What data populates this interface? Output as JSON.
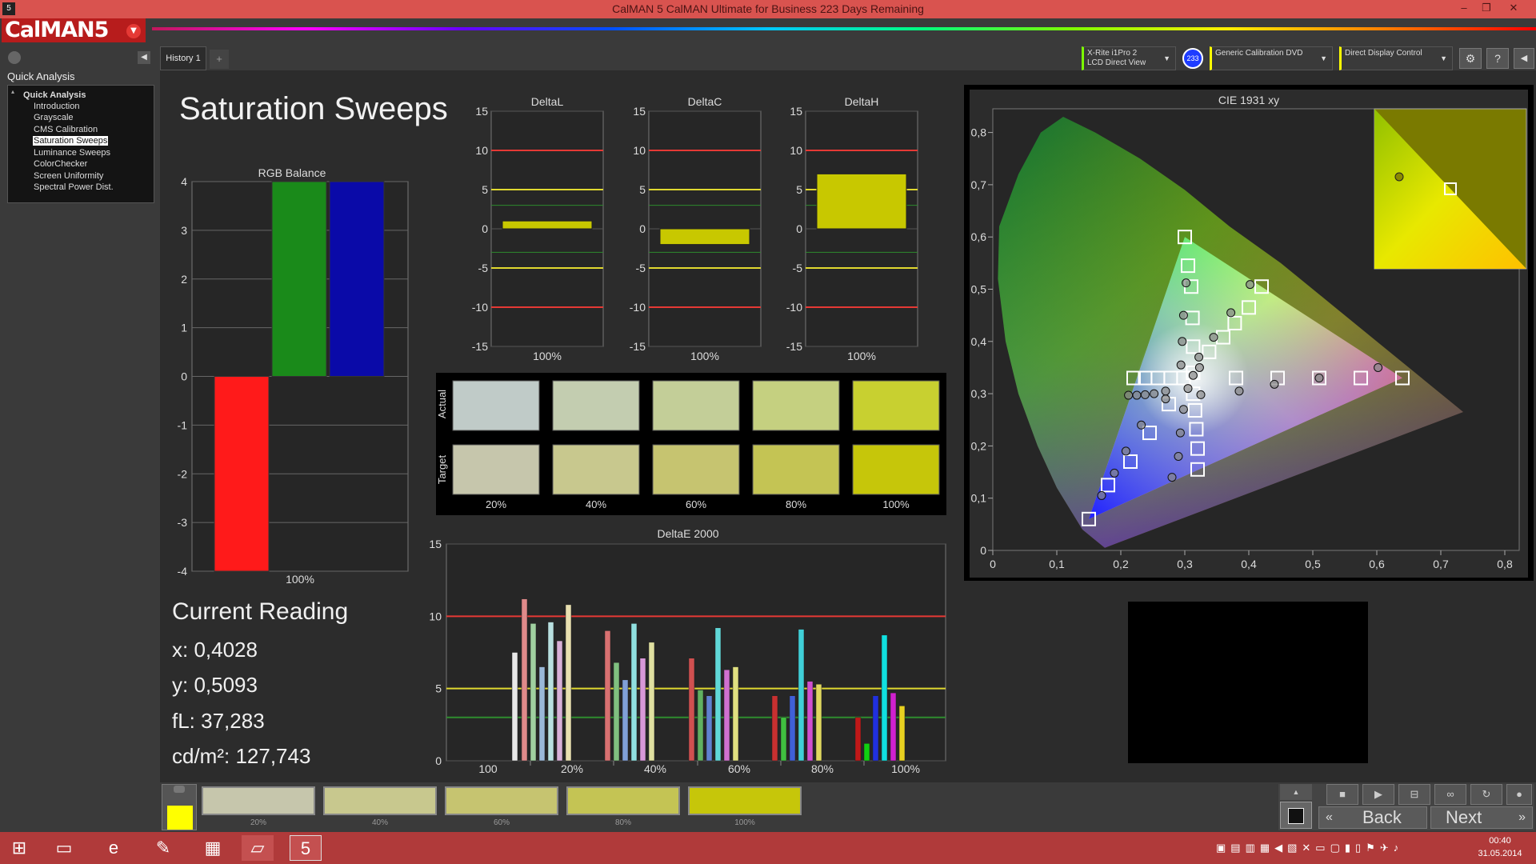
{
  "window": {
    "title": "CalMAN 5 CalMAN Ultimate for Business 223 Days Remaining",
    "logo": "CalMAN5",
    "logo_menu": "▼"
  },
  "tabs": [
    {
      "label": "History 1"
    },
    {
      "label": "+"
    }
  ],
  "devices": [
    {
      "label": "X-Rite i1Pro 2",
      "sub": "LCD Direct View",
      "color": "#7cfc00"
    },
    {
      "label": "233",
      "color": "#1e3cff"
    },
    {
      "label": "Generic Calibration DVD",
      "color": "#ffff00"
    },
    {
      "label": "Direct Display Control",
      "color": "#ffff00"
    }
  ],
  "sidebar": {
    "heading": "Quick Analysis",
    "root": "Quick Analysis",
    "items": [
      "Introduction",
      "Grayscale",
      "CMS Calibration",
      "Saturation Sweeps",
      "Luminance Sweeps",
      "ColorChecker",
      "Screen Uniformity",
      "Spectral Power Dist."
    ],
    "selected": "Saturation Sweeps"
  },
  "page": {
    "title": "Saturation Sweeps"
  },
  "reading": {
    "heading": "Current Reading",
    "x": "x: 0,4028",
    "y": "y: 0,5093",
    "fl": "fL: 37,283",
    "cd": "cd/m²: 127,743"
  },
  "colors": {
    "accent_yellow": "#c8c800",
    "red_line": "#e53935",
    "yellow_line": "#e0d830",
    "green_line": "#2e8b2e"
  },
  "chart_data": [
    {
      "type": "bar",
      "title": "RGB Balance",
      "categories": [
        "100%"
      ],
      "series": [
        {
          "name": "R",
          "values": [
            -4.0
          ],
          "color": "#ff1a1a"
        },
        {
          "name": "G",
          "values": [
            4.0
          ],
          "color": "#1a8a1a"
        },
        {
          "name": "B",
          "values": [
            4.0
          ],
          "color": "#0a0aa8"
        }
      ],
      "ylim": [
        -4,
        4
      ],
      "yticks": [
        "4",
        "3",
        "2",
        "1",
        "0",
        "-1",
        "-2",
        "-3",
        "-4"
      ]
    },
    {
      "type": "bar",
      "title": "DeltaL",
      "categories": [
        "100%"
      ],
      "values": [
        1.0
      ],
      "ylim": [
        -15,
        15
      ],
      "yticks": [
        "15",
        "10",
        "5",
        "0",
        "-5",
        "-10",
        "-15"
      ]
    },
    {
      "type": "bar",
      "title": "DeltaC",
      "categories": [
        "100%"
      ],
      "values": [
        -2.0
      ],
      "ylim": [
        -15,
        15
      ],
      "yticks": [
        "15",
        "10",
        "5",
        "0",
        "-5",
        "-10",
        "-15"
      ]
    },
    {
      "type": "bar",
      "title": "DeltaH",
      "categories": [
        "100%"
      ],
      "values": [
        7.0
      ],
      "ylim": [
        -15,
        15
      ],
      "yticks": [
        "15",
        "10",
        "5",
        "0",
        "-5",
        "-10",
        "-15"
      ]
    },
    {
      "type": "table",
      "title": "Swatches",
      "rows": [
        "Actual",
        "Target"
      ],
      "columns": [
        "20%",
        "40%",
        "60%",
        "80%",
        "100%"
      ],
      "actual": [
        "#c0cbc8",
        "#c3cdb0",
        "#c3ce98",
        "#c5d080",
        "#c8d030"
      ],
      "target": [
        "#c6c6ac",
        "#c8c88e",
        "#c6c470",
        "#c4c454",
        "#c6c60a"
      ]
    },
    {
      "type": "bar",
      "title": "DeltaE 2000",
      "categories": [
        "100",
        "20%",
        "40%",
        "60%",
        "80%",
        "100%"
      ],
      "ylim": [
        0,
        15
      ],
      "yticks": [
        "15",
        "10",
        "5",
        "0"
      ],
      "groups": [
        {
          "label": "100",
          "bars": [
            {
              "value": 7.5,
              "color": "#e8e8e8"
            }
          ]
        },
        {
          "label": "20%",
          "bars": [
            {
              "value": 11.2,
              "color": "#e08a8a"
            },
            {
              "value": 9.5,
              "color": "#a0d0a0"
            },
            {
              "value": 6.5,
              "color": "#9ab8d8"
            },
            {
              "value": 9.6,
              "color": "#b8e0e0"
            },
            {
              "value": 8.3,
              "color": "#d8b0d8"
            },
            {
              "value": 10.8,
              "color": "#e8e0b0"
            }
          ]
        },
        {
          "label": "40%",
          "bars": [
            {
              "value": 9.0,
              "color": "#d87070"
            },
            {
              "value": 6.8,
              "color": "#80c080"
            },
            {
              "value": 5.6,
              "color": "#80a0d8"
            },
            {
              "value": 9.5,
              "color": "#90e0e0"
            },
            {
              "value": 7.1,
              "color": "#d898d8"
            },
            {
              "value": 8.2,
              "color": "#e0e0a0"
            }
          ]
        },
        {
          "label": "60%",
          "bars": [
            {
              "value": 7.1,
              "color": "#d05050"
            },
            {
              "value": 4.9,
              "color": "#60b060"
            },
            {
              "value": 4.5,
              "color": "#6080d0"
            },
            {
              "value": 9.2,
              "color": "#60d8d8"
            },
            {
              "value": 6.3,
              "color": "#d070d0"
            },
            {
              "value": 6.5,
              "color": "#e0e080"
            }
          ]
        },
        {
          "label": "80%",
          "bars": [
            {
              "value": 4.5,
              "color": "#c83030"
            },
            {
              "value": 3.0,
              "color": "#40c040"
            },
            {
              "value": 4.5,
              "color": "#4060d8"
            },
            {
              "value": 9.1,
              "color": "#40d0d8"
            },
            {
              "value": 5.5,
              "color": "#d050d0"
            },
            {
              "value": 5.3,
              "color": "#e0d860"
            }
          ]
        },
        {
          "label": "100%",
          "bars": [
            {
              "value": 3.0,
              "color": "#c01818"
            },
            {
              "value": 1.2,
              "color": "#10d010"
            },
            {
              "value": 4.5,
              "color": "#2030e0"
            },
            {
              "value": 8.7,
              "color": "#10e0e0"
            },
            {
              "value": 4.7,
              "color": "#d020d0"
            },
            {
              "value": 3.8,
              "color": "#e8d020"
            }
          ]
        }
      ],
      "thresholds": [
        {
          "value": 10,
          "color": "#e53935"
        },
        {
          "value": 5,
          "color": "#e0d830"
        },
        {
          "value": 3,
          "color": "#2e8b2e"
        }
      ]
    },
    {
      "type": "scatter",
      "title": "CIE 1931 xy",
      "xlim": [
        0,
        0.85
      ],
      "ylim": [
        0,
        0.85
      ],
      "xticks": [
        "0",
        "0,1",
        "0,2",
        "0,3",
        "0,4",
        "0,5",
        "0,6",
        "0,7",
        "0,8"
      ],
      "yticks": [
        "0",
        "0,1",
        "0,2",
        "0,3",
        "0,4",
        "0,5",
        "0,6",
        "0,7",
        "0,8"
      ],
      "gamut": [
        [
          0.64,
          0.33
        ],
        [
          0.3,
          0.6
        ],
        [
          0.15,
          0.06
        ]
      ],
      "targets": [
        [
          0.3,
          0.6
        ],
        [
          0.305,
          0.545
        ],
        [
          0.31,
          0.505
        ],
        [
          0.312,
          0.445
        ],
        [
          0.313,
          0.39
        ],
        [
          0.313,
          0.34
        ],
        [
          0.64,
          0.33
        ],
        [
          0.575,
          0.33
        ],
        [
          0.51,
          0.33
        ],
        [
          0.445,
          0.33
        ],
        [
          0.38,
          0.33
        ],
        [
          0.15,
          0.06
        ],
        [
          0.18,
          0.125
        ],
        [
          0.215,
          0.17
        ],
        [
          0.245,
          0.225
        ],
        [
          0.275,
          0.28
        ],
        [
          0.42,
          0.505
        ],
        [
          0.4,
          0.465
        ],
        [
          0.378,
          0.435
        ],
        [
          0.36,
          0.408
        ],
        [
          0.338,
          0.38
        ],
        [
          0.22,
          0.33
        ],
        [
          0.238,
          0.33
        ],
        [
          0.258,
          0.33
        ],
        [
          0.278,
          0.33
        ],
        [
          0.298,
          0.33
        ],
        [
          0.32,
          0.155
        ],
        [
          0.32,
          0.195
        ],
        [
          0.318,
          0.232
        ],
        [
          0.316,
          0.268
        ],
        [
          0.313,
          0.3
        ]
      ],
      "measured": [
        [
          0.302,
          0.512
        ],
        [
          0.298,
          0.45
        ],
        [
          0.296,
          0.4
        ],
        [
          0.294,
          0.355
        ],
        [
          0.313,
          0.335
        ],
        [
          0.602,
          0.35
        ],
        [
          0.51,
          0.33
        ],
        [
          0.44,
          0.318
        ],
        [
          0.385,
          0.305
        ],
        [
          0.325,
          0.298
        ],
        [
          0.17,
          0.105
        ],
        [
          0.19,
          0.148
        ],
        [
          0.208,
          0.19
        ],
        [
          0.232,
          0.24
        ],
        [
          0.27,
          0.29
        ],
        [
          0.402,
          0.509
        ],
        [
          0.372,
          0.455
        ],
        [
          0.345,
          0.408
        ],
        [
          0.322,
          0.37
        ],
        [
          0.323,
          0.35
        ],
        [
          0.212,
          0.297
        ],
        [
          0.225,
          0.297
        ],
        [
          0.238,
          0.298
        ],
        [
          0.252,
          0.3
        ],
        [
          0.27,
          0.305
        ],
        [
          0.28,
          0.14
        ],
        [
          0.29,
          0.18
        ],
        [
          0.293,
          0.225
        ],
        [
          0.298,
          0.27
        ],
        [
          0.305,
          0.31
        ]
      ]
    }
  ],
  "bottom_swatches": [
    {
      "label": "20%",
      "color": "#c6c6ac"
    },
    {
      "label": "40%",
      "color": "#c8c88e"
    },
    {
      "label": "60%",
      "color": "#c6c470"
    },
    {
      "label": "80%",
      "color": "#c4c454"
    },
    {
      "label": "100%",
      "color": "#c6c60a"
    }
  ],
  "bottom_current_color": "#ffff00",
  "nav": {
    "back": "Back",
    "next": "Next"
  },
  "taskbar": {
    "time": "00:40",
    "date": "31.05.2014"
  }
}
